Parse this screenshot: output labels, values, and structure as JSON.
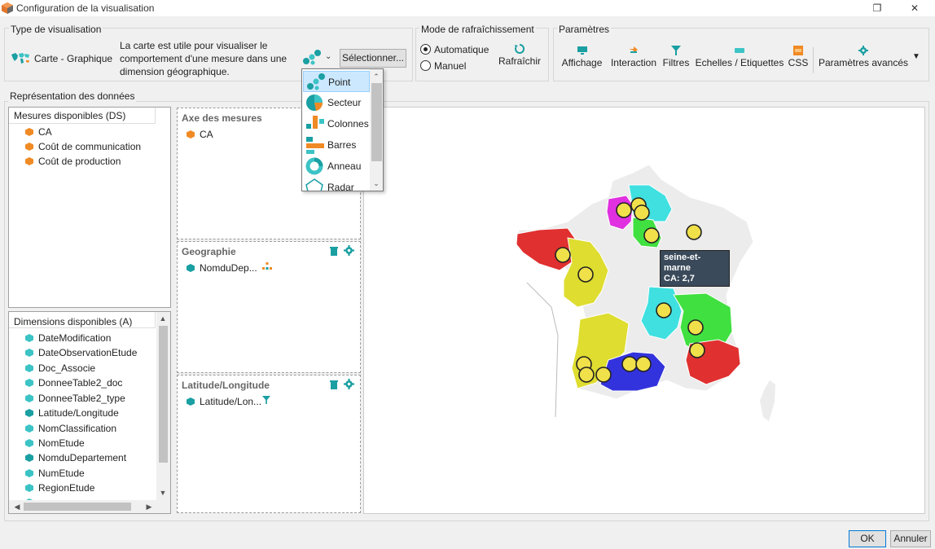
{
  "window": {
    "title": "Configuration de la visualisation",
    "restore_glyph": "❐",
    "close_glyph": "✕"
  },
  "viz_type": {
    "group_label": "Type de visualisation",
    "current": "Carte - Graphique",
    "description": "La carte est utile pour visualiser le comportement d'une mesure dans une dimension géographique.",
    "select_button": "Sélectionner..."
  },
  "refresh": {
    "group_label": "Mode de rafraîchissement",
    "auto_label": "Automatique",
    "manual_label": "Manuel",
    "selected": "Automatique",
    "refresh_button": "Rafraîchir"
  },
  "params": {
    "group_label": "Paramètres",
    "buttons": [
      "Affichage",
      "Interaction",
      "Filtres",
      "Echelles / Etiquettes",
      "CSS",
      "Paramètres avancés"
    ]
  },
  "data_rep": {
    "group_label": "Représentation des données"
  },
  "measures": {
    "header": "Mesures disponibles (DS)",
    "items": [
      "CA",
      "Coût de communication",
      "Coût de production"
    ]
  },
  "dimensions": {
    "header": "Dimensions disponibles (A)",
    "items": [
      "DateModification",
      "DateObservationEtude",
      "Doc_Associe",
      "DonneeTable2_doc",
      "DonneeTable2_type",
      "Latitude/Longitude",
      "NomClassification",
      "NomEtude",
      "NomduDepartement",
      "NumEtude",
      "RegionEtude"
    ]
  },
  "zones": {
    "axis_title": "Axe des mesures",
    "axis_item": "CA",
    "geo_title": "Geographie",
    "geo_item": "NomduDep...",
    "latlon_title": "Latitude/Longitude",
    "latlon_item": "Latitude/Lon..."
  },
  "chart_menu": {
    "items": [
      "Point",
      "Secteur",
      "Colonnes",
      "Barres",
      "Anneau",
      "Radar"
    ],
    "selected": "Point"
  },
  "map": {
    "tooltip_name": "seine-et-marne",
    "tooltip_value": "CA: 2,7",
    "region_colors": {
      "bretagne": "#e03030",
      "pays_de_loire": "#dedd30",
      "idf_west": "#e030e0",
      "idf_north": "#40e0e0",
      "idf_south": "#40e040",
      "auvergne": "#40e0e0",
      "rhone_alpes": "#40e040",
      "paca": "#e03030",
      "aquitaine": "#dedd30",
      "midi_pyrenees": "#3333dd",
      "default": "#ececec"
    },
    "point_color": "#f0e04a"
  },
  "footer": {
    "ok": "OK",
    "cancel": "Annuler"
  }
}
